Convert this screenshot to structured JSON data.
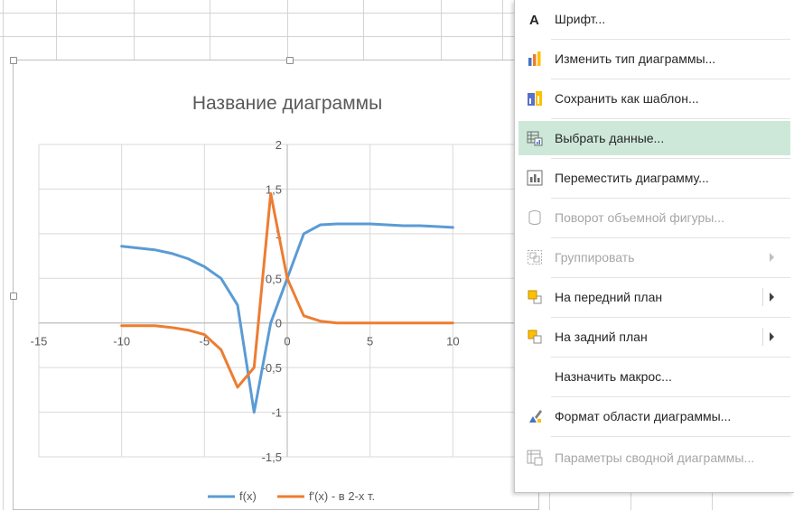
{
  "chart_data": {
    "type": "line",
    "title": "Название диаграммы",
    "xlabel": "",
    "ylabel": "",
    "xlim": [
      -15,
      15
    ],
    "ylim": [
      -1.5,
      2
    ],
    "x_ticks": [
      -15,
      -10,
      -5,
      0,
      5,
      10
    ],
    "x_tick_labels": [
      "-15",
      "-10",
      "-5",
      "0",
      "5",
      "10"
    ],
    "y_ticks": [
      -1.5,
      -1,
      -0.5,
      0,
      0.5,
      1,
      1.5,
      2
    ],
    "y_tick_labels": [
      "-1,5",
      "-1",
      "-0,5",
      "0",
      "0,5",
      "1",
      "1,5",
      "2"
    ],
    "grid": true,
    "legend_position": "bottom",
    "series": [
      {
        "name": "f(x)",
        "color": "#5b9bd5",
        "x": [
          -10,
          -9,
          -8,
          -7,
          -6,
          -5,
          -4,
          -3,
          -2,
          -1,
          0,
          1,
          2,
          3,
          4,
          5,
          6,
          7,
          8,
          9,
          10
        ],
        "y": [
          0.86,
          0.84,
          0.82,
          0.78,
          0.72,
          0.63,
          0.5,
          0.2,
          -1.0,
          0.0,
          0.5,
          1.0,
          1.1,
          1.11,
          1.11,
          1.11,
          1.1,
          1.09,
          1.09,
          1.08,
          1.07
        ]
      },
      {
        "name": "f'(x) - в 2-х т.",
        "color": "#ed7d31",
        "x": [
          -10,
          -9,
          -8,
          -7,
          -6,
          -5,
          -4,
          -3,
          -2,
          -1,
          0,
          1,
          2,
          3,
          4,
          5,
          6,
          7,
          8,
          9,
          10
        ],
        "y": [
          -0.03,
          -0.03,
          -0.03,
          -0.05,
          -0.08,
          -0.13,
          -0.3,
          -0.72,
          -0.5,
          1.45,
          0.5,
          0.08,
          0.02,
          0.0,
          0.0,
          0.0,
          0.0,
          0.0,
          0.0,
          0.0,
          0.0
        ]
      }
    ]
  },
  "context_menu": {
    "items": [
      {
        "label": "Шрифт...",
        "icon": "font-icon",
        "disabled": false,
        "submenu": false
      },
      {
        "label": "Изменить тип диаграммы...",
        "icon": "change-chart-type-icon",
        "disabled": false,
        "submenu": false
      },
      {
        "label": "Сохранить как шаблон...",
        "icon": "save-template-icon",
        "disabled": false,
        "submenu": false
      },
      {
        "label": "Выбрать данные...",
        "icon": "select-data-icon",
        "disabled": false,
        "submenu": false,
        "highlighted": true
      },
      {
        "label": "Переместить диаграмму...",
        "icon": "move-chart-icon",
        "disabled": false,
        "submenu": false
      },
      {
        "label": "Поворот объемной фигуры...",
        "icon": "3d-rotation-icon",
        "disabled": true,
        "submenu": false
      },
      {
        "label": "Группировать",
        "icon": "group-icon",
        "disabled": true,
        "submenu": true
      },
      {
        "label": "На передний план",
        "icon": "bring-to-front-icon",
        "disabled": false,
        "submenu": true
      },
      {
        "label": "На задний план",
        "icon": "send-to-back-icon",
        "disabled": false,
        "submenu": true
      },
      {
        "label": "Назначить макрос...",
        "icon": "",
        "disabled": false,
        "submenu": false
      },
      {
        "label": "Формат области диаграммы...",
        "icon": "format-chart-area-icon",
        "disabled": false,
        "submenu": false
      },
      {
        "label": "Параметры сводной диаграммы...",
        "icon": "pivot-chart-options-icon",
        "disabled": true,
        "submenu": false
      }
    ]
  }
}
